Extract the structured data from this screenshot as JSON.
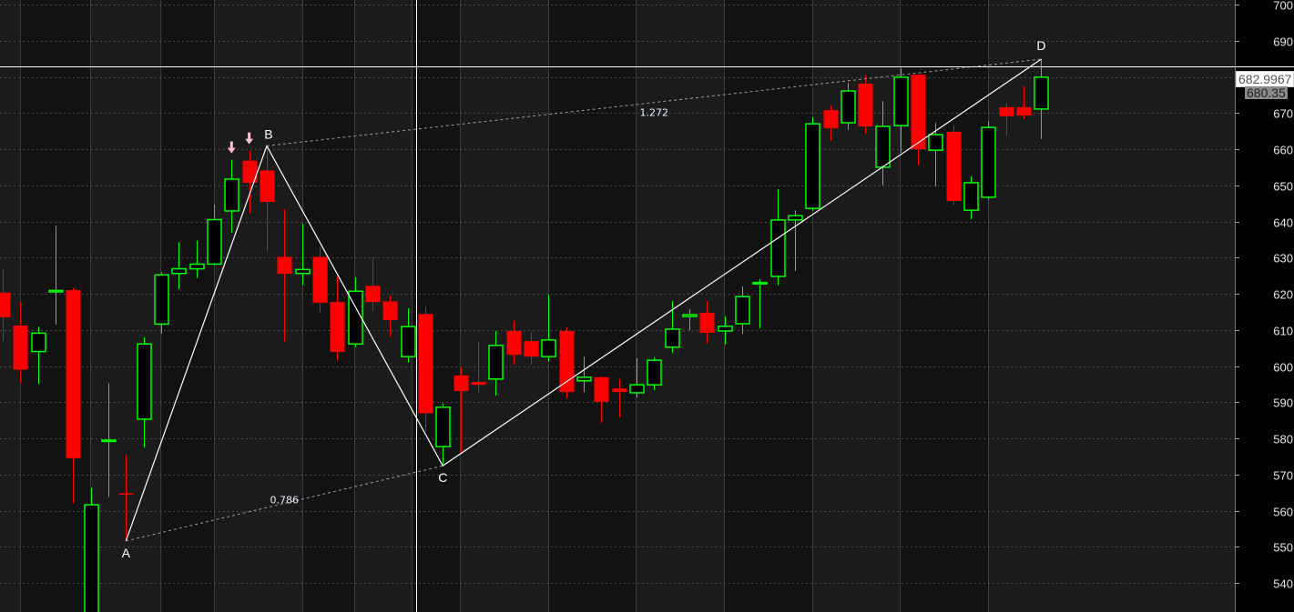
{
  "chart_data": {
    "type": "candlestick",
    "title": "",
    "ylim": [
      535,
      702
    ],
    "yticks": [
      540,
      550,
      560,
      570,
      580,
      590,
      600,
      610,
      620,
      630,
      640,
      650,
      660,
      670,
      680,
      690,
      700
    ],
    "ytick_labels": [
      "540",
      "550",
      "560",
      "570",
      "580",
      "590",
      "600",
      "610",
      "620",
      "630",
      "640",
      "650",
      "660",
      "670",
      "680",
      "690",
      "700"
    ],
    "grid": true,
    "colors": {
      "up": "#00ff00",
      "down": "#ff0000",
      "pattern": "#ffffff",
      "arrow": "#ffc0cb",
      "axis_text": "#e8e8e8"
    },
    "candles_ohlc": [
      [
        620.3,
        626.6,
        606.9,
        613.5
      ],
      [
        611.2,
        617.6,
        595.3,
        599.0
      ],
      [
        604.0,
        610.9,
        595.0,
        609.1
      ],
      [
        620.5,
        638.8,
        611.5,
        620.9
      ],
      [
        621.0,
        621.7,
        562.1,
        574.5
      ],
      [
        530.0,
        566.3,
        528.0,
        561.6
      ],
      [
        579.4,
        595.2,
        563.8,
        579.5
      ],
      [
        564.8,
        575.3,
        551.6,
        564.6
      ],
      [
        585.3,
        608.0,
        577.4,
        606.1
      ],
      [
        611.6,
        625.9,
        609.0,
        625.2
      ],
      [
        625.6,
        634.2,
        621.3,
        626.9
      ],
      [
        626.9,
        634.7,
        624.3,
        628.2
      ],
      [
        628.2,
        644.7,
        627.8,
        640.5
      ],
      [
        642.9,
        657.1,
        636.9,
        651.7
      ],
      [
        656.8,
        659.6,
        642.2,
        650.7
      ],
      [
        654.1,
        660.9,
        631.8,
        645.4
      ],
      [
        630.2,
        643.4,
        606.8,
        625.5
      ],
      [
        625.6,
        639.4,
        622.3,
        626.7
      ],
      [
        630.2,
        633.0,
        614.8,
        617.5
      ],
      [
        617.7,
        624.8,
        601.5,
        603.9
      ],
      [
        606.1,
        624.5,
        605.2,
        620.7
      ],
      [
        622.2,
        630.0,
        615.2,
        617.7
      ],
      [
        617.9,
        619.5,
        608.1,
        612.7
      ],
      [
        602.6,
        616.0,
        601.0,
        610.9
      ],
      [
        614.4,
        616.5,
        581.9,
        586.9
      ],
      [
        577.7,
        589.6,
        572.4,
        588.6
      ],
      [
        597.4,
        599.6,
        576.0,
        593.1
      ],
      [
        595.6,
        606.7,
        592.8,
        594.8
      ],
      [
        596.4,
        609.7,
        591.8,
        605.7
      ],
      [
        609.7,
        612.5,
        600.4,
        603.1
      ],
      [
        606.9,
        609.4,
        600.4,
        602.6
      ],
      [
        602.6,
        619.7,
        601.4,
        607.2
      ],
      [
        609.7,
        610.7,
        591.0,
        592.8
      ],
      [
        595.9,
        602.6,
        592.8,
        596.9
      ],
      [
        596.9,
        597.1,
        584.3,
        590.1
      ],
      [
        593.8,
        596.4,
        585.8,
        592.8
      ],
      [
        592.6,
        602.1,
        591.3,
        594.8
      ],
      [
        594.8,
        602.4,
        593.3,
        601.6
      ],
      [
        605.2,
        618.0,
        603.6,
        610.2
      ],
      [
        613.7,
        615.7,
        609.9,
        614.2
      ],
      [
        614.7,
        618.0,
        606.2,
        609.2
      ],
      [
        609.7,
        613.7,
        605.9,
        611.0
      ],
      [
        611.7,
        622.0,
        608.9,
        619.2
      ],
      [
        622.9,
        624.0,
        610.4,
        623.1
      ],
      [
        624.8,
        648.9,
        622.3,
        640.4
      ],
      [
        640.4,
        643.1,
        626.3,
        641.6
      ],
      [
        643.6,
        668.8,
        643.0,
        667.0
      ],
      [
        670.8,
        672.1,
        662.3,
        665.8
      ],
      [
        667.3,
        678.4,
        665.3,
        676.1
      ],
      [
        678.1,
        680.4,
        664.3,
        666.3
      ],
      [
        655.0,
        673.3,
        650.0,
        666.3
      ],
      [
        666.5,
        682.4,
        659.0,
        679.9
      ],
      [
        680.6,
        680.6,
        655.5,
        660.0
      ],
      [
        659.7,
        667.3,
        649.7,
        664.0
      ],
      [
        664.8,
        666.5,
        644.7,
        645.7
      ],
      [
        643.1,
        652.5,
        640.6,
        650.7
      ],
      [
        646.7,
        667.8,
        646.0,
        666.0
      ],
      [
        671.6,
        672.8,
        663.8,
        669.1
      ],
      [
        671.6,
        677.4,
        668.3,
        669.3
      ],
      [
        671.1,
        684.9,
        662.8,
        679.9
      ]
    ],
    "pattern": {
      "points": [
        {
          "label": "A",
          "candle_index": 7,
          "price": 551.6
        },
        {
          "label": "B",
          "candle_index": 15,
          "price": 660.9
        },
        {
          "label": "C",
          "candle_index": 25,
          "price": 572.4
        },
        {
          "label": "D",
          "candle_index": 59,
          "price": 684.9
        }
      ],
      "ratios": [
        {
          "label": "0.786",
          "from": "A",
          "to": "C"
        },
        {
          "label": "1.272",
          "from": "B",
          "to": "D"
        }
      ]
    },
    "signal_arrows": [
      {
        "candle_index": 13,
        "direction": "down"
      },
      {
        "candle_index": 14,
        "direction": "down"
      }
    ],
    "crosshair": {
      "candle_index": 23.5,
      "price_label": "682.9967",
      "price": 682.9967
    },
    "last_price_label": "680.35"
  }
}
